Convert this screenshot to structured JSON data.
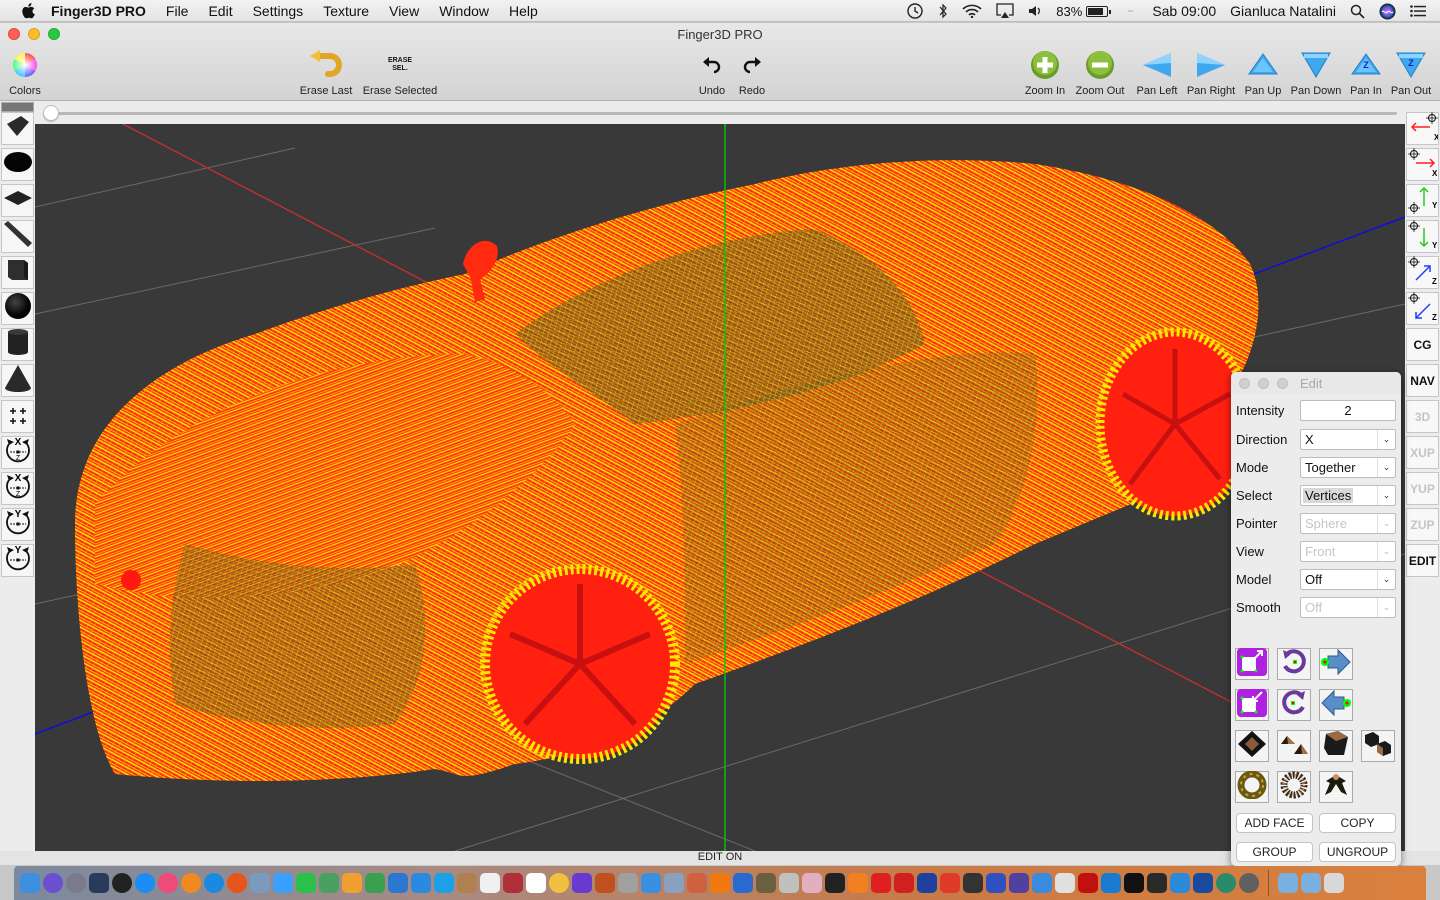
{
  "menubar": {
    "app_name": "Finger3D PRO",
    "items": [
      "File",
      "Edit",
      "Settings",
      "Texture",
      "View",
      "Window",
      "Help"
    ],
    "battery": "83%",
    "clock": "Sab 09:00",
    "user": "Gianluca Natalini"
  },
  "window": {
    "title": "Finger3D PRO",
    "status": "EDIT ON"
  },
  "toolbar": {
    "colors": "Colors",
    "erase_last": "Erase Last",
    "erase_selected": "Erase Selected",
    "erase_sel_icon_text": "ERASE SEL.",
    "undo": "Undo",
    "redo": "Redo",
    "zoom_in": "Zoom In",
    "zoom_out": "Zoom Out",
    "pan_left": "Pan Left",
    "pan_right": "Pan Right",
    "pan_up": "Pan Up",
    "pan_down": "Pan Down",
    "pan_in": "Pan In",
    "pan_out": "Pan Out",
    "pan_z_glyph": "Z"
  },
  "slider": {
    "value_fraction": 0.0
  },
  "left_tools": [
    "curved-surface",
    "ellipse",
    "plane",
    "ramp",
    "cube",
    "sphere",
    "cylinder",
    "cone",
    "grid-points",
    "rotate-x-z-left",
    "rotate-x-z-right",
    "rotate-y-left",
    "rotate-y-right"
  ],
  "right_tools": {
    "axis_moves": [
      {
        "axis": "X",
        "dir": "left",
        "color": "#ff2020"
      },
      {
        "axis": "X",
        "dir": "right",
        "color": "#ff2020"
      },
      {
        "axis": "Y",
        "dir": "up",
        "color": "#22cc22"
      },
      {
        "axis": "Y",
        "dir": "down",
        "color": "#22cc22"
      },
      {
        "axis": "Z",
        "dir": "in",
        "color": "#2040ff"
      },
      {
        "axis": "Z",
        "dir": "out",
        "color": "#2040ff"
      }
    ],
    "buttons": [
      {
        "label": "CG",
        "enabled": true
      },
      {
        "label": "NAV",
        "enabled": true
      },
      {
        "label": "3D",
        "enabled": false
      },
      {
        "label": "XUP",
        "enabled": false
      },
      {
        "label": "YUP",
        "enabled": false
      },
      {
        "label": "ZUP",
        "enabled": false
      },
      {
        "label": "EDIT",
        "enabled": true
      }
    ]
  },
  "edit_panel": {
    "title": "Edit",
    "fields": {
      "intensity": {
        "label": "Intensity",
        "value": "2"
      },
      "direction": {
        "label": "Direction",
        "value": "X"
      },
      "mode": {
        "label": "Mode",
        "value": "Together"
      },
      "select": {
        "label": "Select",
        "value": "Vertices"
      },
      "pointer": {
        "label": "Pointer",
        "value": "Sphere",
        "enabled": false
      },
      "view": {
        "label": "View",
        "value": "Front",
        "enabled": false
      },
      "model": {
        "label": "Model",
        "value": "Off"
      },
      "smooth": {
        "label": "Smooth",
        "value": "Off",
        "enabled": false
      }
    },
    "tool_icons": [
      "scale-up",
      "rotate-ccw",
      "move-forward",
      "scale-down",
      "rotate-cw",
      "move-back",
      "extrude-face",
      "split-cones",
      "bevel-box",
      "twin-cubes",
      "torus",
      "radial-array",
      "branch-shape"
    ],
    "buttons": {
      "add_face": "ADD FACE",
      "copy": "COPY",
      "group": "GROUP",
      "ungroup": "UNGROUP"
    }
  },
  "viewport": {
    "axis_colors": {
      "x": "#c03030",
      "y": "#00cc00",
      "z": "#1010d0"
    },
    "mesh_colors": {
      "wire": "#ffee00",
      "fill": "#ff2010"
    },
    "background": "#393939"
  },
  "dock": {
    "apps": [
      "Finder",
      "Siri",
      "Launchpad",
      "Mission Control",
      "Dashboard",
      "App Store",
      "iTunes",
      "iBooks",
      "Safari",
      "Firefox",
      "Preview",
      "Messenger",
      "FaceTime",
      "Maps",
      "Pages",
      "Numbers",
      "Keynote",
      "TestFlight",
      "Skype",
      "Notes",
      "Calendar",
      "Photo Booth",
      "TextEdit",
      "Photos",
      "iMovie",
      "GarageBand",
      "Image Capture",
      "DVD Player",
      "Migration",
      "Instruments",
      "VLC",
      "QuickTime",
      "GIMP",
      "Script",
      "Photo App",
      "Cleaner",
      "Blender",
      "SketchUp",
      "ODA Viewer",
      "Audacity",
      "Joystick",
      "Cards",
      "Slack",
      "Screen",
      "Xcode",
      "Preview 2",
      "FileZilla",
      "VS Code",
      "Terminal",
      "Printer",
      "Wunderlist",
      "VirtualBox",
      "Time Machine",
      "System Preferences",
      "Applications",
      "Downloads",
      "Trash"
    ]
  }
}
